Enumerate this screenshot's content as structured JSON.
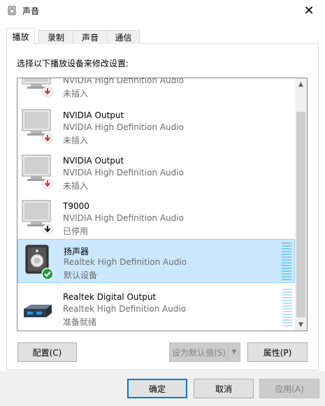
{
  "window": {
    "title": "声音",
    "close_glyph": "✕"
  },
  "tabs": [
    {
      "label": "播放",
      "active": true
    },
    {
      "label": "录制",
      "active": false
    },
    {
      "label": "声音",
      "active": false
    },
    {
      "label": "通信",
      "active": false
    }
  ],
  "instruction": "选择以下播放设备来修改设置:",
  "devices": [
    {
      "name": "",
      "description": "NVIDIA High Definition Audio",
      "status": "未插入",
      "icon": "monitor-icon",
      "badge": "unplugged-arrow-icon",
      "selected": false
    },
    {
      "name": "NVIDIA Output",
      "description": "NVIDIA High Definition Audio",
      "status": "未插入",
      "icon": "monitor-icon",
      "badge": "unplugged-arrow-icon",
      "selected": false
    },
    {
      "name": "NVIDIA Output",
      "description": "NVIDIA High Definition Audio",
      "status": "未插入",
      "icon": "monitor-icon",
      "badge": "unplugged-arrow-icon",
      "selected": false
    },
    {
      "name": "T9000",
      "description": "NVIDIA High Definition Audio",
      "status": "已停用",
      "icon": "monitor-icon",
      "badge": "disabled-arrow-icon",
      "selected": false
    },
    {
      "name": "扬声器",
      "description": "Realtek High Definition Audio",
      "status": "默认设备",
      "icon": "speaker-icon",
      "badge": "default-check-icon",
      "selected": true
    },
    {
      "name": "Realtek Digital Output",
      "description": "Realtek High Definition Audio",
      "status": "准备就绪",
      "icon": "digital-output-icon",
      "badge": "",
      "selected": false
    }
  ],
  "buttons": {
    "configure": "配置(C)",
    "set_default": "设为默认值(S)",
    "properties": "属性(P)",
    "ok": "确定",
    "cancel": "取消",
    "apply": "应用(A)"
  },
  "colors": {
    "selection_bg": "#cce8ff",
    "selection_border": "#99d1ff",
    "accent": "#0078d7",
    "unplugged_red": "#d83a2a",
    "default_green": "#1a9e3b"
  }
}
